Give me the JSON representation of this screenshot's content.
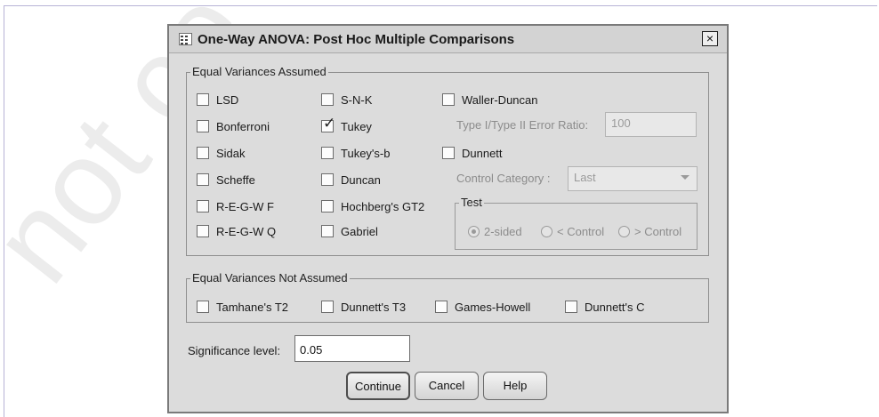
{
  "watermark": {
    "text": "not co"
  },
  "dialog": {
    "title": "One-Way ANOVA: Post Hoc Multiple Comparisons",
    "close_glyph": "×"
  },
  "equal_assumed": {
    "legend": "Equal Variances Assumed",
    "col1": [
      {
        "label": "LSD",
        "checked": false
      },
      {
        "label": "Bonferroni",
        "checked": false
      },
      {
        "label": "Sidak",
        "checked": false
      },
      {
        "label": "Scheffe",
        "checked": false
      },
      {
        "label": "R-E-G-W F",
        "checked": false
      },
      {
        "label": "R-E-G-W Q",
        "checked": false
      }
    ],
    "col2": [
      {
        "label": "S-N-K",
        "checked": false
      },
      {
        "label": "Tukey",
        "checked": true
      },
      {
        "label": "Tukey's-b",
        "checked": false
      },
      {
        "label": "Duncan",
        "checked": false
      },
      {
        "label": "Hochberg's GT2",
        "checked": false
      },
      {
        "label": "Gabriel",
        "checked": false
      }
    ],
    "waller_duncan": {
      "label": "Waller-Duncan",
      "checked": false
    },
    "error_ratio": {
      "label": "Type I/Type II Error Ratio:",
      "value": "100"
    },
    "dunnett": {
      "label": "Dunnett",
      "checked": false
    },
    "control_category": {
      "label": "Control Category :",
      "value": "Last"
    },
    "test": {
      "legend": "Test",
      "options": [
        "2-sided",
        "< Control",
        "> Control"
      ],
      "selected": "2-sided"
    }
  },
  "equal_not_assumed": {
    "legend": "Equal Variances Not Assumed",
    "items": [
      {
        "label": "Tamhane's T2",
        "checked": false
      },
      {
        "label": "Dunnett's T3",
        "checked": false
      },
      {
        "label": "Games-Howell",
        "checked": false
      },
      {
        "label": "Dunnett's C",
        "checked": false
      }
    ]
  },
  "significance": {
    "label": "Significance level:",
    "value": "0.05"
  },
  "buttons": {
    "continue": "Continue",
    "cancel": "Cancel",
    "help": "Help"
  }
}
